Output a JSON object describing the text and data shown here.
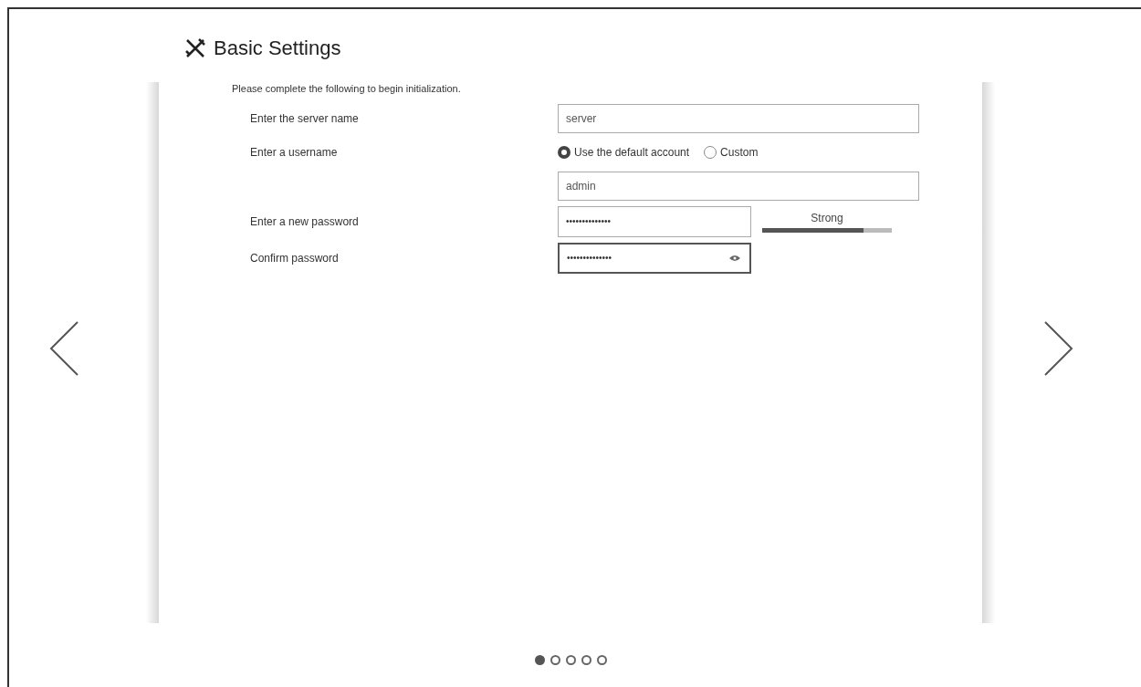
{
  "title": "Basic Settings",
  "intro": "Please complete the following to begin initialization.",
  "fields": [
    {
      "kind": "text",
      "label": "Enter the server name",
      "value": "server"
    },
    {
      "kind": "radio",
      "label": "Enter a username",
      "options": [
        {
          "label": "Use the default account",
          "selected": true
        },
        {
          "label": "Custom",
          "selected": false
        }
      ]
    },
    {
      "kind": "text",
      "value": "admin"
    },
    {
      "kind": "password",
      "label": "Enter a new password",
      "value": "••••••••••••••",
      "strength": {
        "label": "Strong",
        "level": 0.78
      }
    },
    {
      "kind": "password",
      "label": "Confirm password",
      "value": "••••••••••••••",
      "reveal": true,
      "focused": true
    }
  ],
  "pager": [
    {
      "selected": true
    },
    {
      "selected": false
    },
    {
      "selected": false
    },
    {
      "selected": false
    },
    {
      "selected": false
    }
  ]
}
